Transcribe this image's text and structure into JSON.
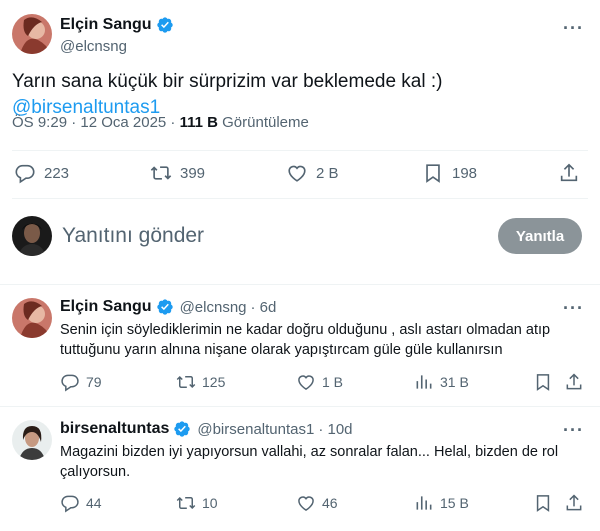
{
  "main_tweet": {
    "author_name": "Elçin Sangu",
    "author_handle": "@elcnsng",
    "text": "Yarın sana küçük bir sürprizim var beklemede kal :) ",
    "mention": "@birsenaltuntas1",
    "time": "ÖS 9:29 · 12 Oca 2025 · ",
    "views_count": "111 B",
    "views_label": " Görüntüleme",
    "replies": "223",
    "retweets": "399",
    "likes": "2 B",
    "bookmarks": "198",
    "more": "···"
  },
  "composer": {
    "placeholder": "Yanıtını gönder",
    "button": "Yanıtla"
  },
  "replies": [
    {
      "author_name": "Elçin Sangu",
      "author_handle": "@elcnsng",
      "age": "· 6d",
      "line1": "Senin için söylediklerimin ne kadar doğru olduğunu , aslı astarı olmadan atıp",
      "line2": "tuttuğunu yarın alnına nişane olarak yapıştırcam güle güle kullanırsın",
      "replies": "79",
      "retweets": "125",
      "likes": "1 B",
      "views": "31 B",
      "more": "···"
    },
    {
      "author_name": "birsenaltuntas",
      "author_handle": "@birsenaltuntas1",
      "age": "· 10d",
      "line1": "Magazini bizden iyi yapıyorsun vallahi, az sonralar falan... Helal, bizden de rol",
      "line2": "çalıyorsun.",
      "replies": "44",
      "retweets": "10",
      "likes": "46",
      "views": "15 B",
      "more": "···"
    }
  ],
  "colors": {
    "accent": "#1d9bf0",
    "muted": "#536471",
    "text": "#0f1419",
    "button": "#8b9499"
  },
  "icons": [
    "verified-badge-icon",
    "reply-icon",
    "retweet-icon",
    "like-icon",
    "bookmark-icon",
    "share-icon",
    "views-icon",
    "more-icon"
  ]
}
